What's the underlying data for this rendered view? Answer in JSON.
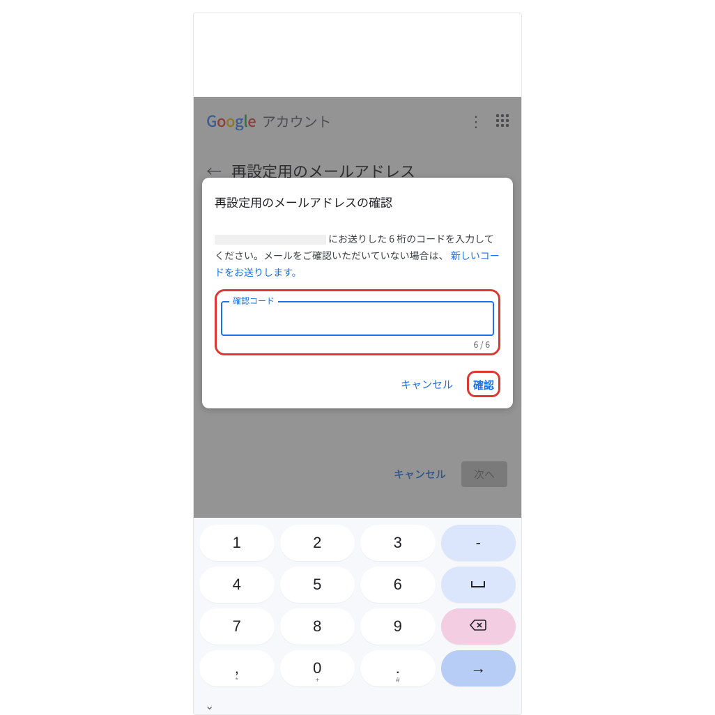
{
  "header": {
    "brand": "Google",
    "account_label": "アカウント"
  },
  "page": {
    "title": "再設定用のメールアドレス"
  },
  "modal": {
    "title": "再設定用のメールアドレスの確認",
    "body_part1": "にお送りした 6 桁のコードを入力してください。メールをご確認いただいていない場合は、",
    "resend_link": "新しいコードをお送りします。",
    "field_label": "確認コード",
    "counter": "6 / 6",
    "cancel": "キャンセル",
    "confirm": "確認"
  },
  "under_actions": {
    "cancel": "キャンセル",
    "next": "次へ"
  },
  "keyboard": {
    "rows": [
      [
        {
          "k": "1",
          "l": ""
        },
        {
          "k": "2",
          "l": ""
        },
        {
          "k": "3",
          "l": ""
        },
        {
          "k": "-",
          "l": "",
          "blue": true
        }
      ],
      [
        {
          "k": "4",
          "l": ""
        },
        {
          "k": "5",
          "l": ""
        },
        {
          "k": "6",
          "l": ""
        },
        {
          "k": "⌴",
          "l": "",
          "blue": true,
          "space": true
        }
      ],
      [
        {
          "k": "7",
          "l": ""
        },
        {
          "k": "8",
          "l": ""
        },
        {
          "k": "9",
          "l": ""
        },
        {
          "k": "⌫",
          "l": "",
          "pink": true
        }
      ],
      [
        {
          "k": ",",
          "l": "*"
        },
        {
          "k": "0",
          "l": "+"
        },
        {
          "k": ".",
          "l": "#"
        },
        {
          "k": "→",
          "l": "",
          "enter": true
        }
      ]
    ]
  }
}
